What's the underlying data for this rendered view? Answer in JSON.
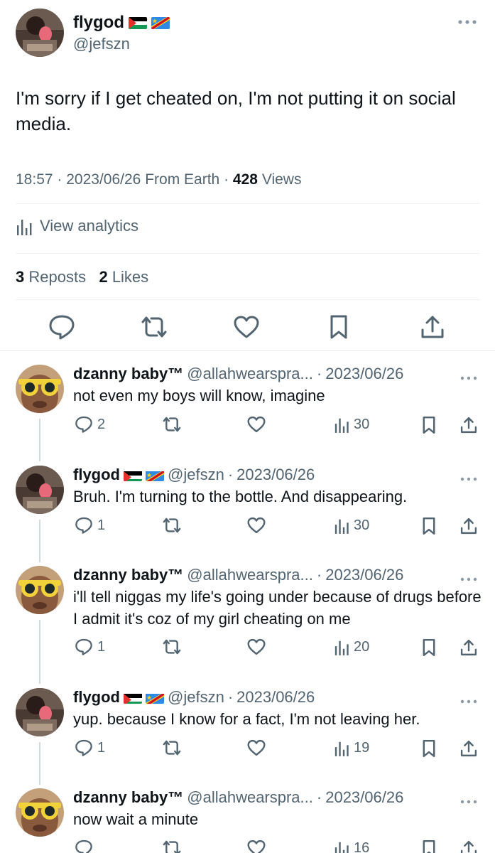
{
  "main_tweet": {
    "author_name": "flygod",
    "author_handle": "@jefszn",
    "flags": [
      "palestine-flag",
      "dr-congo-flag"
    ],
    "text": "I'm sorry if I get cheated on, I'm not putting it on social media.",
    "time": "18:57",
    "date": "2023/06/26",
    "source": "From Earth",
    "views_count": "428",
    "views_label": "Views",
    "analytics_label": "View analytics",
    "reposts_count": "3",
    "reposts_label": "Reposts",
    "likes_count": "2",
    "likes_label": "Likes"
  },
  "replies": [
    {
      "author_name": "dzanny baby™",
      "author_handle": "@allahwearspra...",
      "date": "2023/06/26",
      "text": "not even my boys will know, imagine",
      "reply_count": "2",
      "repost_count": "",
      "like_count": "",
      "views_count": "30",
      "avatar": "yellow-glasses-avatar"
    },
    {
      "author_name": "flygod",
      "author_handle": "@jefszn",
      "date": "2023/06/26",
      "text": "Bruh. I'm turning to the bottle. And disappearing.",
      "reply_count": "1",
      "repost_count": "",
      "like_count": "",
      "views_count": "30",
      "avatar": "flygod-avatar"
    },
    {
      "author_name": "dzanny baby™",
      "author_handle": "@allahwearspra...",
      "date": "2023/06/26",
      "text": "i'll tell niggas my life's going under because of drugs before I admit it's coz of my girl cheating on me",
      "reply_count": "1",
      "repost_count": "",
      "like_count": "",
      "views_count": "20",
      "avatar": "yellow-glasses-avatar"
    },
    {
      "author_name": "flygod",
      "author_handle": "@jefszn",
      "date": "2023/06/26",
      "text": "yup. because I know for a fact, I'm not leaving her.",
      "reply_count": "1",
      "repost_count": "",
      "like_count": "",
      "views_count": "19",
      "avatar": "flygod-avatar"
    },
    {
      "author_name": "dzanny baby™",
      "author_handle": "@allahwearspra...",
      "date": "2023/06/26",
      "text": "now wait a minute",
      "reply_count": "",
      "repost_count": "",
      "like_count": "",
      "views_count": "16",
      "avatar": "yellow-glasses-avatar"
    }
  ],
  "separator": "·",
  "colors": {
    "text_primary": "#0f1419",
    "text_secondary": "#536471",
    "divider": "#eff3f4",
    "thread_line": "#cfd9de"
  }
}
